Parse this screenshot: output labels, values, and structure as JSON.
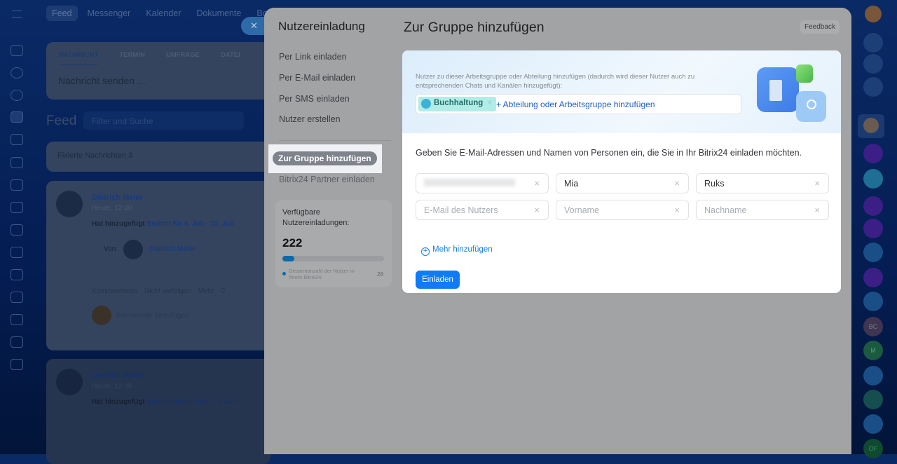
{
  "background": {
    "topnav": [
      "Feed",
      "Messenger",
      "Kalender",
      "Dokumente",
      "Boards"
    ],
    "composer_tabs": [
      "NACHRICHT",
      "TERMIN",
      "UMFRAGE",
      "DATEI"
    ],
    "composer_placeholder": "Nachricht senden ...",
    "feed_title": "Feed",
    "filter_placeholder": "Filter und Suche",
    "pinned": "Fixierte Nachrichten  3",
    "posts": [
      {
        "author": "Dietrich Meier",
        "time": "Heute, 12:40",
        "action": "Hat hinzugefügt",
        "link": "Bericht für 4. Juli - 10. Juli",
        "from_label": "Von:",
        "from": "Dietrich Meier",
        "actions": [
          "Kommentieren",
          "Nicht verfolgen",
          "Mehr"
        ],
        "views": "0",
        "comment_placeholder": "Kommentar hinzufügen"
      },
      {
        "author": "Dietrich Meier",
        "time": "Heute, 12:39",
        "action": "Hat hinzugefügt",
        "link": "Bericht für 27. Juni - 3. Juli"
      }
    ],
    "right_avatars": [
      "BC",
      "M",
      "OF"
    ]
  },
  "modal": {
    "nav_title": "Nutzereinladung",
    "nav_items": [
      "Per Link einladen",
      "Per E-Mail einladen",
      "Per SMS einladen",
      "Nutzer erstellen"
    ],
    "active_item": "Zur Gruppe hinzufügen",
    "partner_item": "Bitrix24 Partner einladen",
    "stats": {
      "label": "Verfügbare Nutzereinladungen:",
      "value": "222",
      "legend": "Gesamtanzahl der Nutzer in Ihrem Bitrix24:",
      "total": "28",
      "progress": 0.12
    },
    "title": "Zur Gruppe hinzufügen",
    "feedback": "Feedback",
    "group_hint": "Nutzer zu dieser Arbeitsgruppe oder Abteilung hinzufügen (dadurch wird dieser Nutzer auch zu entsprechenden Chats und Kanälen hinzugefügt):",
    "group_tag": "Buchhaltung",
    "add_group": "+ Abteilung oder Arbeitsgruppe hinzufügen",
    "instructions": "Geben Sie E-Mail-Adressen und Namen von Personen ein, die Sie in Ihr Bitrix24 einladen möchten.",
    "rows": [
      {
        "email": "",
        "first": "Mia",
        "last": "Ruks"
      },
      {
        "email_ph": "E-Mail des Nutzers",
        "first_ph": "Vorname",
        "last_ph": "Nachname"
      }
    ],
    "more": "Mehr hinzufügen",
    "invite": "Einladen"
  },
  "colors": {
    "accent": "#0f7bf5",
    "tag": "#b2ece6"
  }
}
